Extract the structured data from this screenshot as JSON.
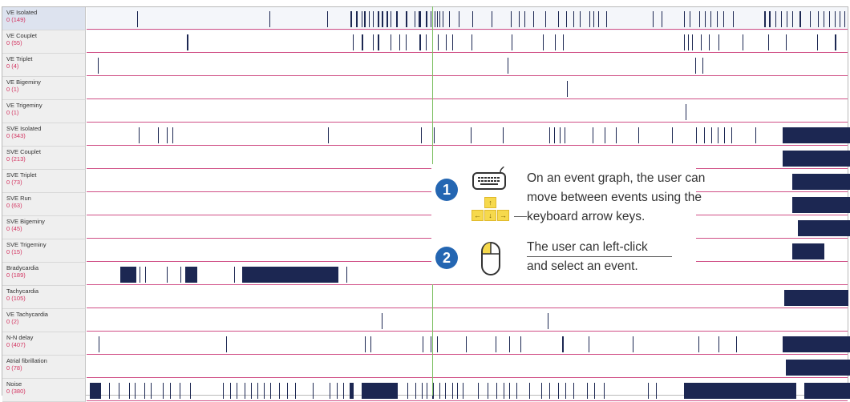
{
  "rows": [
    {
      "name": "VE Isolated",
      "count": "0 (149)",
      "selected": true,
      "marks": [
        [
          63,
          1
        ],
        [
          228,
          1
        ],
        [
          300,
          1
        ],
        [
          329,
          2
        ],
        [
          336,
          2
        ],
        [
          343,
          1
        ],
        [
          346,
          2
        ],
        [
          352,
          1
        ],
        [
          357,
          1
        ],
        [
          363,
          2
        ],
        [
          368,
          2
        ],
        [
          374,
          2
        ],
        [
          379,
          1
        ],
        [
          386,
          2
        ],
        [
          398,
          2
        ],
        [
          409,
          1
        ],
        [
          414,
          3
        ],
        [
          423,
          2
        ],
        [
          429,
          1
        ],
        [
          434,
          1
        ],
        [
          437,
          1
        ],
        [
          440,
          1
        ],
        [
          444,
          1
        ],
        [
          452,
          1
        ],
        [
          464,
          1
        ],
        [
          481,
          1
        ],
        [
          505,
          1
        ],
        [
          529,
          1
        ],
        [
          539,
          1
        ],
        [
          546,
          1
        ],
        [
          557,
          1
        ],
        [
          572,
          1
        ],
        [
          588,
          1
        ],
        [
          598,
          1
        ],
        [
          607,
          1
        ],
        [
          615,
          1
        ],
        [
          627,
          1
        ],
        [
          632,
          1
        ],
        [
          638,
          1
        ],
        [
          648,
          1
        ],
        [
          706,
          1
        ],
        [
          717,
          1
        ],
        [
          745,
          1
        ],
        [
          752,
          1
        ],
        [
          764,
          1
        ],
        [
          771,
          1
        ],
        [
          778,
          1
        ],
        [
          786,
          1
        ],
        [
          794,
          1
        ],
        [
          806,
          1
        ],
        [
          845,
          2
        ],
        [
          851,
          2
        ],
        [
          859,
          1
        ],
        [
          866,
          1
        ],
        [
          873,
          1
        ],
        [
          880,
          1
        ],
        [
          889,
          2
        ],
        [
          902,
          1
        ],
        [
          912,
          1
        ],
        [
          919,
          1
        ],
        [
          926,
          1
        ],
        [
          933,
          1
        ],
        [
          939,
          1
        ],
        [
          945,
          1
        ]
      ]
    },
    {
      "name": "VE Couplet",
      "count": "0 (55)",
      "marks": [
        [
          125,
          2
        ],
        [
          332,
          1
        ],
        [
          343,
          2
        ],
        [
          357,
          1
        ],
        [
          363,
          2
        ],
        [
          379,
          1
        ],
        [
          390,
          1
        ],
        [
          398,
          1
        ],
        [
          415,
          2
        ],
        [
          423,
          1
        ],
        [
          431,
          1
        ],
        [
          438,
          1
        ],
        [
          448,
          1
        ],
        [
          456,
          1
        ],
        [
          480,
          1
        ],
        [
          530,
          1
        ],
        [
          569,
          1
        ],
        [
          584,
          1
        ],
        [
          594,
          1
        ],
        [
          745,
          1
        ],
        [
          750,
          1
        ],
        [
          755,
          1
        ],
        [
          766,
          1
        ],
        [
          776,
          1
        ],
        [
          788,
          1
        ],
        [
          818,
          1
        ],
        [
          850,
          1
        ],
        [
          872,
          1
        ],
        [
          911,
          1
        ],
        [
          933,
          2
        ]
      ]
    },
    {
      "name": "VE Triplet",
      "count": "0 (4)",
      "marks": [
        [
          14,
          1
        ],
        [
          525,
          1
        ],
        [
          759,
          1
        ],
        [
          768,
          1
        ]
      ]
    },
    {
      "name": "VE Bigeminy",
      "count": "0 (1)",
      "marks": [
        [
          599,
          1
        ]
      ]
    },
    {
      "name": "VE Trigeminy",
      "count": "0 (1)",
      "marks": [
        [
          747,
          1
        ]
      ]
    },
    {
      "name": "SVE Isolated",
      "count": "0 (343)",
      "marks": [
        [
          65,
          1
        ],
        [
          89,
          1
        ],
        [
          100,
          1
        ],
        [
          107,
          1
        ],
        [
          301,
          1
        ],
        [
          417,
          1
        ],
        [
          433,
          1
        ],
        [
          479,
          1
        ],
        [
          519,
          1
        ],
        [
          577,
          1
        ],
        [
          583,
          1
        ],
        [
          590,
          1
        ],
        [
          596,
          1
        ],
        [
          631,
          1
        ],
        [
          646,
          1
        ],
        [
          660,
          1
        ],
        [
          688,
          1
        ],
        [
          730,
          1
        ],
        [
          760,
          1
        ],
        [
          770,
          1
        ],
        [
          779,
          1
        ],
        [
          787,
          1
        ],
        [
          795,
          1
        ],
        [
          804,
          1
        ],
        [
          834,
          1
        ],
        [
          868,
          85
        ]
      ]
    },
    {
      "name": "SVE Couplet",
      "count": "0 (213)",
      "marks": [
        [
          868,
          85
        ]
      ]
    },
    {
      "name": "SVE Triplet",
      "count": "0 (73)",
      "marks": [
        [
          880,
          73
        ]
      ]
    },
    {
      "name": "SVE Run",
      "count": "0 (63)",
      "marks": [
        [
          880,
          73
        ]
      ]
    },
    {
      "name": "SVE Bigeminy",
      "count": "0 (45)",
      "marks": [
        [
          887,
          66
        ]
      ]
    },
    {
      "name": "SVE Trigeminy",
      "count": "0 (15)",
      "marks": [
        [
          880,
          40
        ]
      ]
    },
    {
      "name": "Bradycardia",
      "count": "0 (189)",
      "marks": [
        [
          42,
          20
        ],
        [
          66,
          1
        ],
        [
          73,
          1
        ],
        [
          100,
          1
        ],
        [
          117,
          1
        ],
        [
          123,
          15
        ],
        [
          184,
          1
        ],
        [
          194,
          120
        ],
        [
          324,
          1
        ]
      ]
    },
    {
      "name": "Tachycardia",
      "count": "0 (105)",
      "marks": [
        [
          870,
          80
        ]
      ]
    },
    {
      "name": "VE Tachycardia",
      "count": "0 (2)",
      "marks": [
        [
          368,
          1
        ],
        [
          575,
          1
        ]
      ]
    },
    {
      "name": "N-N delay",
      "count": "0 (407)",
      "marks": [
        [
          15,
          1
        ],
        [
          174,
          1
        ],
        [
          347,
          1
        ],
        [
          354,
          1
        ],
        [
          419,
          1
        ],
        [
          429,
          1
        ],
        [
          437,
          1
        ],
        [
          473,
          1
        ],
        [
          510,
          1
        ],
        [
          527,
          1
        ],
        [
          541,
          1
        ],
        [
          593,
          2
        ],
        [
          626,
          1
        ],
        [
          681,
          1
        ],
        [
          763,
          1
        ],
        [
          788,
          1
        ],
        [
          810,
          1
        ],
        [
          868,
          85
        ]
      ]
    },
    {
      "name": "Atrial fibrillation",
      "count": "0 (78)",
      "marks": [
        [
          872,
          81
        ]
      ]
    },
    {
      "name": "Noise",
      "count": "0 (380)",
      "marks": [
        [
          4,
          14
        ],
        [
          28,
          1
        ],
        [
          40,
          1
        ],
        [
          53,
          1
        ],
        [
          60,
          1
        ],
        [
          72,
          1
        ],
        [
          80,
          1
        ],
        [
          95,
          1
        ],
        [
          104,
          1
        ],
        [
          116,
          1
        ],
        [
          129,
          1
        ],
        [
          170,
          1
        ],
        [
          179,
          1
        ],
        [
          187,
          1
        ],
        [
          197,
          1
        ],
        [
          205,
          1
        ],
        [
          213,
          1
        ],
        [
          221,
          1
        ],
        [
          229,
          1
        ],
        [
          240,
          1
        ],
        [
          250,
          1
        ],
        [
          260,
          1
        ],
        [
          282,
          1
        ],
        [
          303,
          1
        ],
        [
          312,
          1
        ],
        [
          320,
          1
        ],
        [
          328,
          5
        ],
        [
          343,
          45
        ],
        [
          400,
          1
        ],
        [
          410,
          1
        ],
        [
          418,
          1
        ],
        [
          424,
          1
        ],
        [
          431,
          2
        ],
        [
          440,
          1
        ],
        [
          447,
          1
        ],
        [
          456,
          1
        ],
        [
          462,
          1
        ],
        [
          469,
          1
        ],
        [
          488,
          1
        ],
        [
          500,
          1
        ],
        [
          511,
          1
        ],
        [
          520,
          1
        ],
        [
          527,
          1
        ],
        [
          536,
          1
        ],
        [
          552,
          1
        ],
        [
          567,
          1
        ],
        [
          577,
          1
        ],
        [
          588,
          1
        ],
        [
          597,
          1
        ],
        [
          607,
          1
        ],
        [
          624,
          1
        ],
        [
          633,
          1
        ],
        [
          645,
          1
        ],
        [
          700,
          1
        ],
        [
          710,
          1
        ],
        [
          745,
          140
        ],
        [
          895,
          58
        ]
      ]
    }
  ],
  "callout": {
    "step1_number": "1",
    "step1_lines": [
      "On an event graph, the user can",
      "move between events using the",
      "keyboard arrow keys."
    ],
    "step2_number": "2",
    "step2_lines": [
      "The user can left-click",
      "and select an event."
    ],
    "keys": [
      "↑",
      "←",
      "↓",
      "→"
    ],
    "keyboard_icon": "keyboard-icon",
    "mouse_icon": "mouse-icon",
    "arrow_keys_icon": "arrow-keys-icon",
    "key_color": "#f6d94c",
    "badge_color": "#2466b2"
  },
  "colors": {
    "event_mark": "#1c2752",
    "baseline": "#d04f86",
    "cursor": "#7dc062",
    "count_text": "#d3325f"
  }
}
